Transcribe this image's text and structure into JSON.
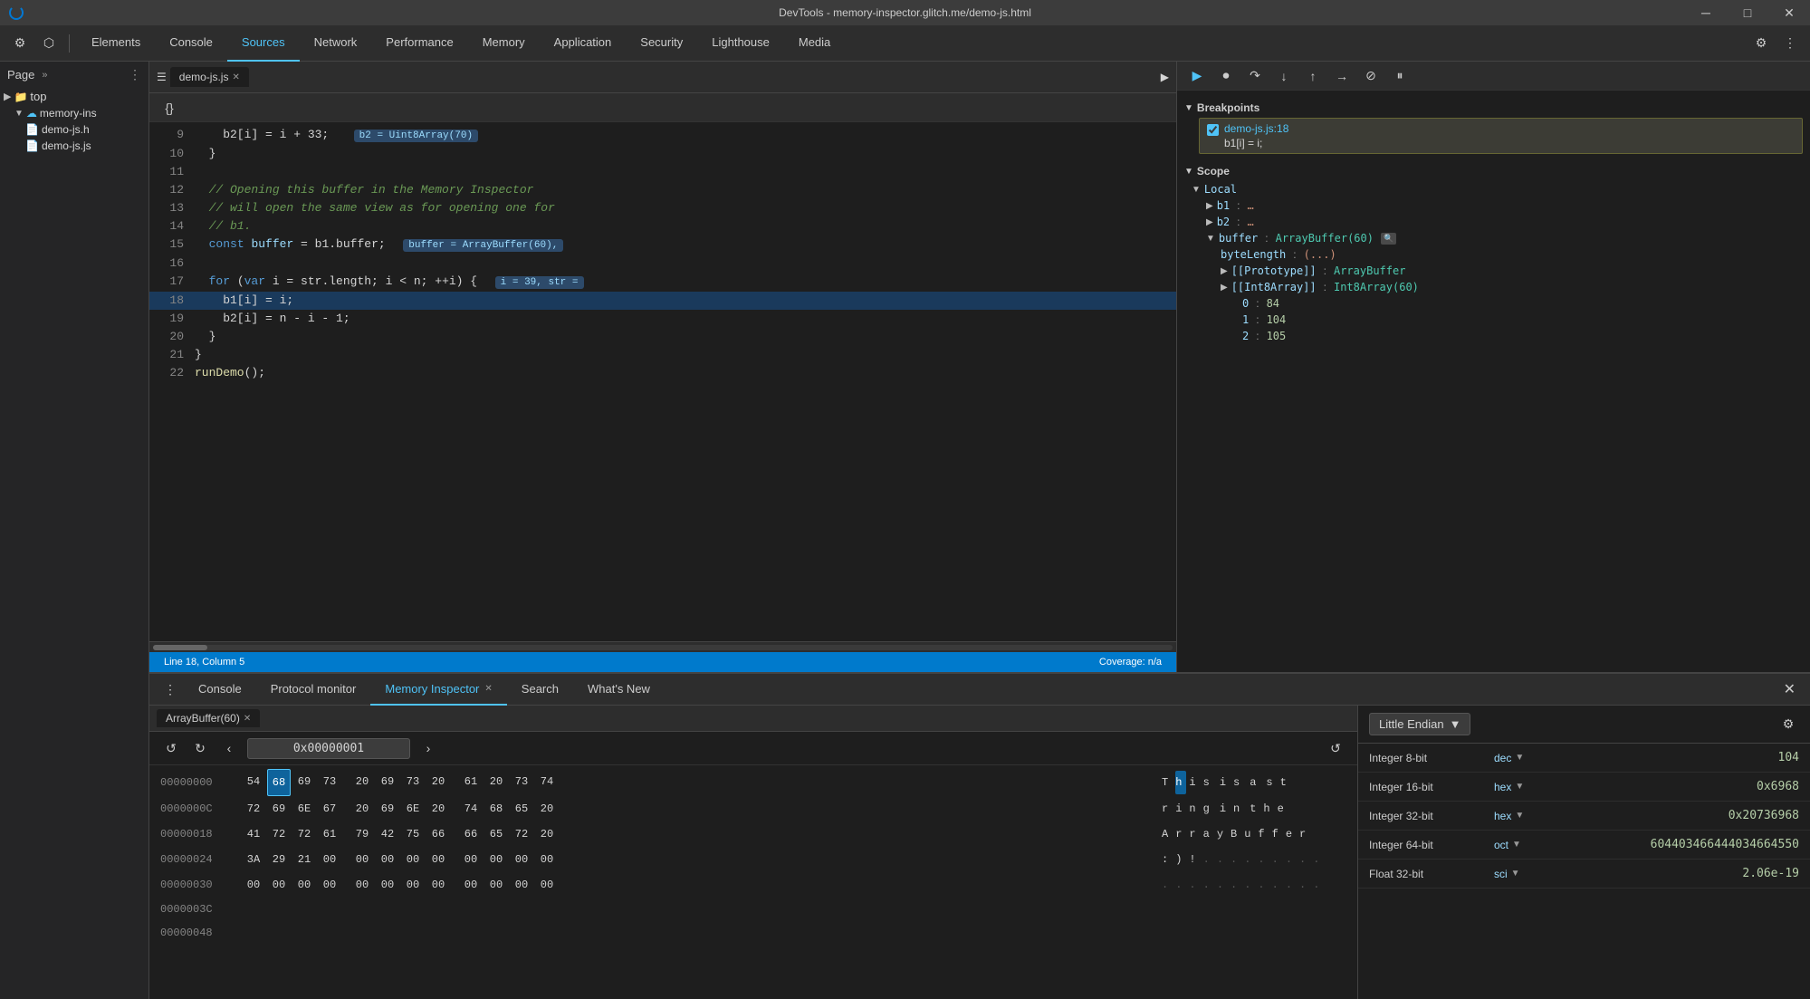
{
  "titleBar": {
    "title": "DevTools - memory-inspector.glitch.me/demo-js.html",
    "minimizeLabel": "─",
    "maximizeLabel": "□",
    "closeLabel": "✕"
  },
  "mainToolbar": {
    "tabs": [
      {
        "id": "elements",
        "label": "Elements",
        "active": false
      },
      {
        "id": "console",
        "label": "Console",
        "active": false
      },
      {
        "id": "sources",
        "label": "Sources",
        "active": true
      },
      {
        "id": "network",
        "label": "Network",
        "active": false
      },
      {
        "id": "performance",
        "label": "Performance",
        "active": false
      },
      {
        "id": "memory",
        "label": "Memory",
        "active": false
      },
      {
        "id": "application",
        "label": "Application",
        "active": false
      },
      {
        "id": "security",
        "label": "Security",
        "active": false
      },
      {
        "id": "lighthouse",
        "label": "Lighthouse",
        "active": false
      },
      {
        "id": "media",
        "label": "Media",
        "active": false
      }
    ]
  },
  "sidebar": {
    "pageLabel": "Page",
    "topItem": "top",
    "items": [
      {
        "label": "memory-ins",
        "icon": "☁",
        "indent": 1
      },
      {
        "label": "demo-js.h",
        "icon": "📄",
        "indent": 2
      },
      {
        "label": "demo-js.js",
        "icon": "📄",
        "indent": 2
      }
    ]
  },
  "editor": {
    "filename": "demo-js.js",
    "statusBar": {
      "line": "Line 18, Column 5",
      "coverage": "Coverage: n/a"
    },
    "lines": [
      {
        "num": 9,
        "content": "    b2[i] = i + 33;   b2 = Uint8Array(70)"
      },
      {
        "num": 10,
        "content": "  }"
      },
      {
        "num": 11,
        "content": ""
      },
      {
        "num": 12,
        "content": "  // Opening this buffer in the Memory Inspector"
      },
      {
        "num": 13,
        "content": "  // will open the same view as for opening one for"
      },
      {
        "num": 14,
        "content": "  // b1."
      },
      {
        "num": 15,
        "content": "  const buffer = b1.buffer;  buffer = ArrayBuffer(60),"
      },
      {
        "num": 16,
        "content": ""
      },
      {
        "num": 17,
        "content": "  for (var i = str.length; i < n; ++i) {  i = 39, str ="
      },
      {
        "num": 18,
        "content": "    b1[i] = i;",
        "highlighted": true
      },
      {
        "num": 19,
        "content": "    b2[i] = n - i - 1;"
      },
      {
        "num": 20,
        "content": "  }"
      },
      {
        "num": 21,
        "content": "}"
      },
      {
        "num": 22,
        "content": "runDemo();"
      }
    ]
  },
  "debugger": {
    "toolbar": {
      "resumeLabel": "▶",
      "pauseLabel": "⏸",
      "stepOverLabel": "↷",
      "stepIntoLabel": "↓",
      "stepOutLabel": "↑",
      "stepBackLabel": "↺"
    },
    "breakpoints": {
      "sectionLabel": "Breakpoints",
      "item": {
        "file": "demo-js.js:18",
        "code": "b1[i] = i;"
      }
    },
    "scope": {
      "sectionLabel": "Scope",
      "local": {
        "label": "Local",
        "items": [
          {
            "key": "b1",
            "val": "…"
          },
          {
            "key": "b2",
            "val": "…"
          },
          {
            "key": "buffer",
            "val": "ArrayBuffer(60)",
            "expanded": true,
            "hasMemory": true
          },
          {
            "key": "byteLength",
            "val": "(…)",
            "indent": 2
          },
          {
            "key": "[[Prototype]]",
            "val": "ArrayBuffer",
            "indent": 2
          },
          {
            "key": "[[Int8Array]]",
            "val": "Int8Array(60)",
            "indent": 2
          },
          {
            "key": "0",
            "val": "84",
            "indent": 3
          },
          {
            "key": "1",
            "val": "104",
            "indent": 3
          },
          {
            "key": "2",
            "val": "105",
            "indent": 3
          }
        ]
      }
    }
  },
  "bottomPanel": {
    "tabs": [
      {
        "id": "console",
        "label": "Console",
        "active": false
      },
      {
        "id": "protocol-monitor",
        "label": "Protocol monitor",
        "active": false
      },
      {
        "id": "memory-inspector",
        "label": "Memory Inspector",
        "active": true,
        "hasClose": true
      },
      {
        "id": "search",
        "label": "Search",
        "active": false
      },
      {
        "id": "whats-new",
        "label": "What's New",
        "active": false
      }
    ],
    "closeLabel": "✕"
  },
  "memoryInspector": {
    "bufferTab": {
      "label": "ArrayBuffer(60)",
      "closeLabel": "✕"
    },
    "toolbar": {
      "prevLabel": "‹",
      "nextLabel": "›",
      "address": "0x00000001",
      "refreshLabel": "↺"
    },
    "hexRows": [
      {
        "addr": "00000000",
        "bytes": [
          "54",
          "68",
          "69",
          "73",
          "20",
          "69",
          "73",
          "20",
          "61",
          "20",
          "73",
          "74"
        ],
        "ascii": [
          "T",
          "h",
          "i",
          "s",
          " ",
          "i",
          "s",
          " ",
          "a",
          " ",
          "s",
          "t"
        ],
        "selectedByte": 1
      },
      {
        "addr": "0000000C",
        "bytes": [
          "72",
          "69",
          "6E",
          "67",
          "20",
          "69",
          "6E",
          "20",
          "74",
          "68",
          "65",
          "20"
        ],
        "ascii": [
          "r",
          "i",
          "n",
          "g",
          " ",
          "i",
          "n",
          " ",
          "t",
          "h",
          "e",
          " "
        ]
      },
      {
        "addr": "00000018",
        "bytes": [
          "41",
          "72",
          "72",
          "61",
          "79",
          "42",
          "75",
          "66",
          "66",
          "65",
          "72",
          "20"
        ],
        "ascii": [
          "A",
          "r",
          "r",
          "a",
          "y",
          "B",
          "u",
          "f",
          "f",
          "e",
          "r",
          " "
        ]
      },
      {
        "addr": "00000024",
        "bytes": [
          "3A",
          "29",
          "21",
          "00",
          "00",
          "00",
          "00",
          "00",
          "00",
          "00",
          "00",
          "00"
        ],
        "ascii": [
          ":",
          ")",
          "!",
          ".",
          ".",
          ".",
          ".",
          ".",
          ".",
          ".",
          ".",
          "."
        ]
      },
      {
        "addr": "00000030",
        "bytes": [
          "00",
          "00",
          "00",
          "00",
          "00",
          "00",
          "00",
          "00",
          "00",
          "00",
          "00",
          "00"
        ],
        "ascii": [
          ".",
          ".",
          ".",
          ".",
          ".",
          ".",
          ".",
          ".",
          ".",
          ".",
          ".",
          "."
        ]
      },
      {
        "addr": "0000003C",
        "bytes": [],
        "ascii": []
      },
      {
        "addr": "00000048",
        "bytes": [],
        "ascii": []
      }
    ],
    "dataInspector": {
      "endian": "Little Endian",
      "rows": [
        {
          "label": "Integer 8-bit",
          "format": "dec",
          "value": "104"
        },
        {
          "label": "Integer 16-bit",
          "format": "hex",
          "value": "0x6968"
        },
        {
          "label": "Integer 32-bit",
          "format": "hex",
          "value": "0x20736968"
        },
        {
          "label": "Integer 64-bit",
          "format": "oct",
          "value": "604403466444034664550"
        },
        {
          "label": "Float 32-bit",
          "format": "sci",
          "value": "2.06e-19"
        }
      ]
    }
  }
}
